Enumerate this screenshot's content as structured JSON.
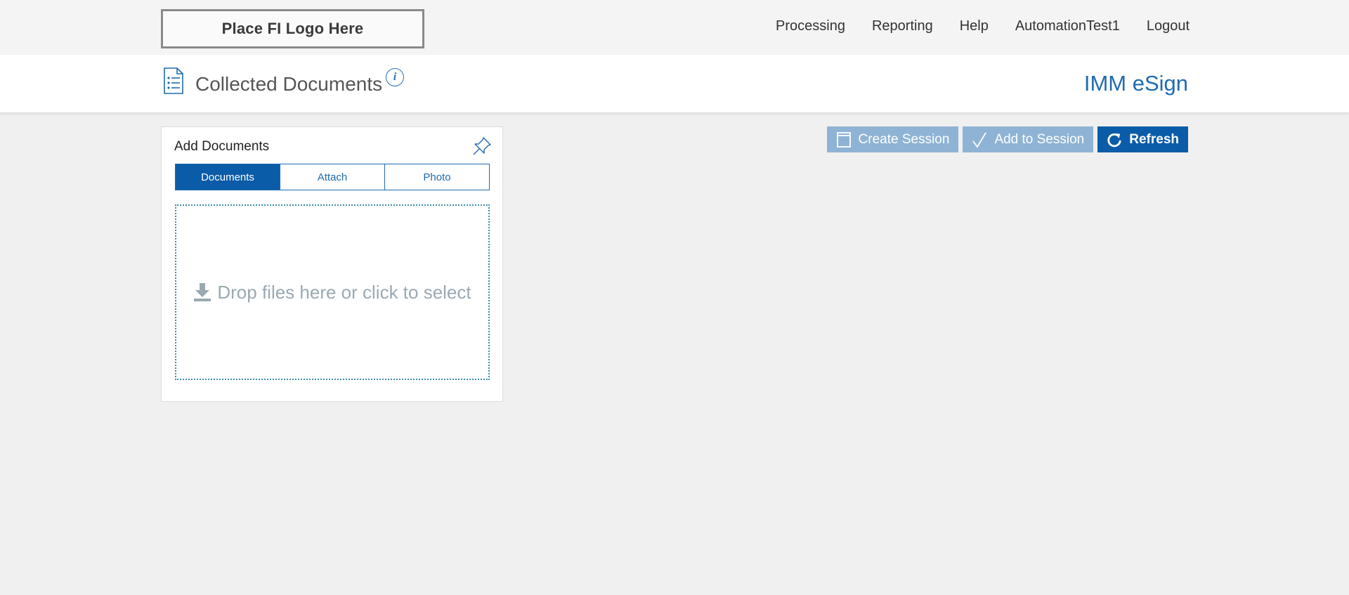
{
  "header": {
    "logo_text": "Place FI Logo Here",
    "nav": [
      "Processing",
      "Reporting",
      "Help",
      "AutomationTest1",
      "Logout"
    ]
  },
  "titlebar": {
    "title": "Collected Documents",
    "info_icon": "i",
    "brand": "IMM eSign"
  },
  "toolbar": {
    "create_session": "Create Session",
    "add_to_session": "Add to Session",
    "refresh": "Refresh"
  },
  "panel": {
    "title": "Add Documents",
    "tabs": [
      "Documents",
      "Attach",
      "Photo"
    ],
    "active_tab": "Documents",
    "dropzone_text": "Drop files here or click to select"
  },
  "colors": {
    "accent": "#0b5ca8",
    "disabled_button": "#8fb3d4",
    "brand_text": "#1f6bb0",
    "dropzone_text": "#9aa9b2"
  },
  "icons": {
    "title": "document-list-icon",
    "info": "info-icon",
    "pin": "pin-icon",
    "create_session": "window-icon",
    "add_to_session": "checkmark-icon",
    "refresh": "refresh-icon",
    "dropzone": "download-icon"
  }
}
